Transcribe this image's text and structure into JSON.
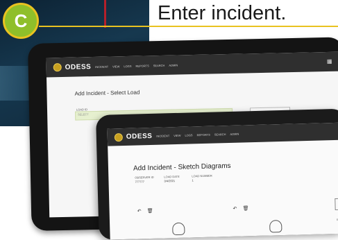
{
  "step": {
    "letter": "C",
    "caption": "Enter incident."
  },
  "colors": {
    "badge_fill": "#8fbf2a",
    "badge_ring": "#e9c220",
    "accent_line": "#e9c220",
    "topbar": "#2f2f2f"
  },
  "app": {
    "logo_text": "ODESS",
    "nav": [
      "INCIDENT",
      "VIEW",
      "LOGS",
      "REPORTS",
      "SEARCH",
      "ADMIN"
    ],
    "icons": [
      "grid-icon",
      "gear-icon"
    ]
  },
  "screen_select_load": {
    "title": "Add Incident - Select Load",
    "field_label": "LOAD ID",
    "field_value": "SELECT",
    "button_label": "SELECT"
  },
  "screen_sketch": {
    "title": "Add Incident - Sketch Diagrams",
    "meta": [
      {
        "label": "OBSERVER ID",
        "value": "777777"
      },
      {
        "label": "LOAD DATE",
        "value": "3/4/2021"
      },
      {
        "label": "LOAD NUMBER",
        "value": "1"
      }
    ],
    "side_text": "B"
  }
}
